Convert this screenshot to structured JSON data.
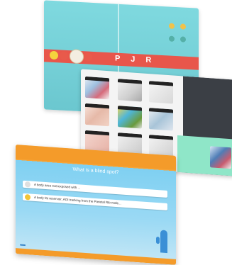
{
  "back_screen": {
    "band_text": "P J R",
    "title": "",
    "subtitle": "",
    "subtitle2": "",
    "bottom_label": "",
    "colors": {
      "band": "#e8564b",
      "bg": "#7fd9df"
    }
  },
  "mid_screen": {
    "label": "",
    "tiles": [
      "tile-1",
      "tile-2",
      "tile-3",
      "tile-4",
      "tile-5",
      "tile-6",
      "tile-7",
      "tile-8",
      "tile-9"
    ]
  },
  "front_screen": {
    "question": "What is a blind spot?",
    "answers": [
      "A body area overexposed with ...",
      "A body fat reservoir, AOI tracking from the Parietal Rib node..."
    ],
    "cta": "",
    "colors": {
      "header": "#f49b2a",
      "bg": "#7fd0f2",
      "cactus": "#3a8fd6"
    }
  }
}
